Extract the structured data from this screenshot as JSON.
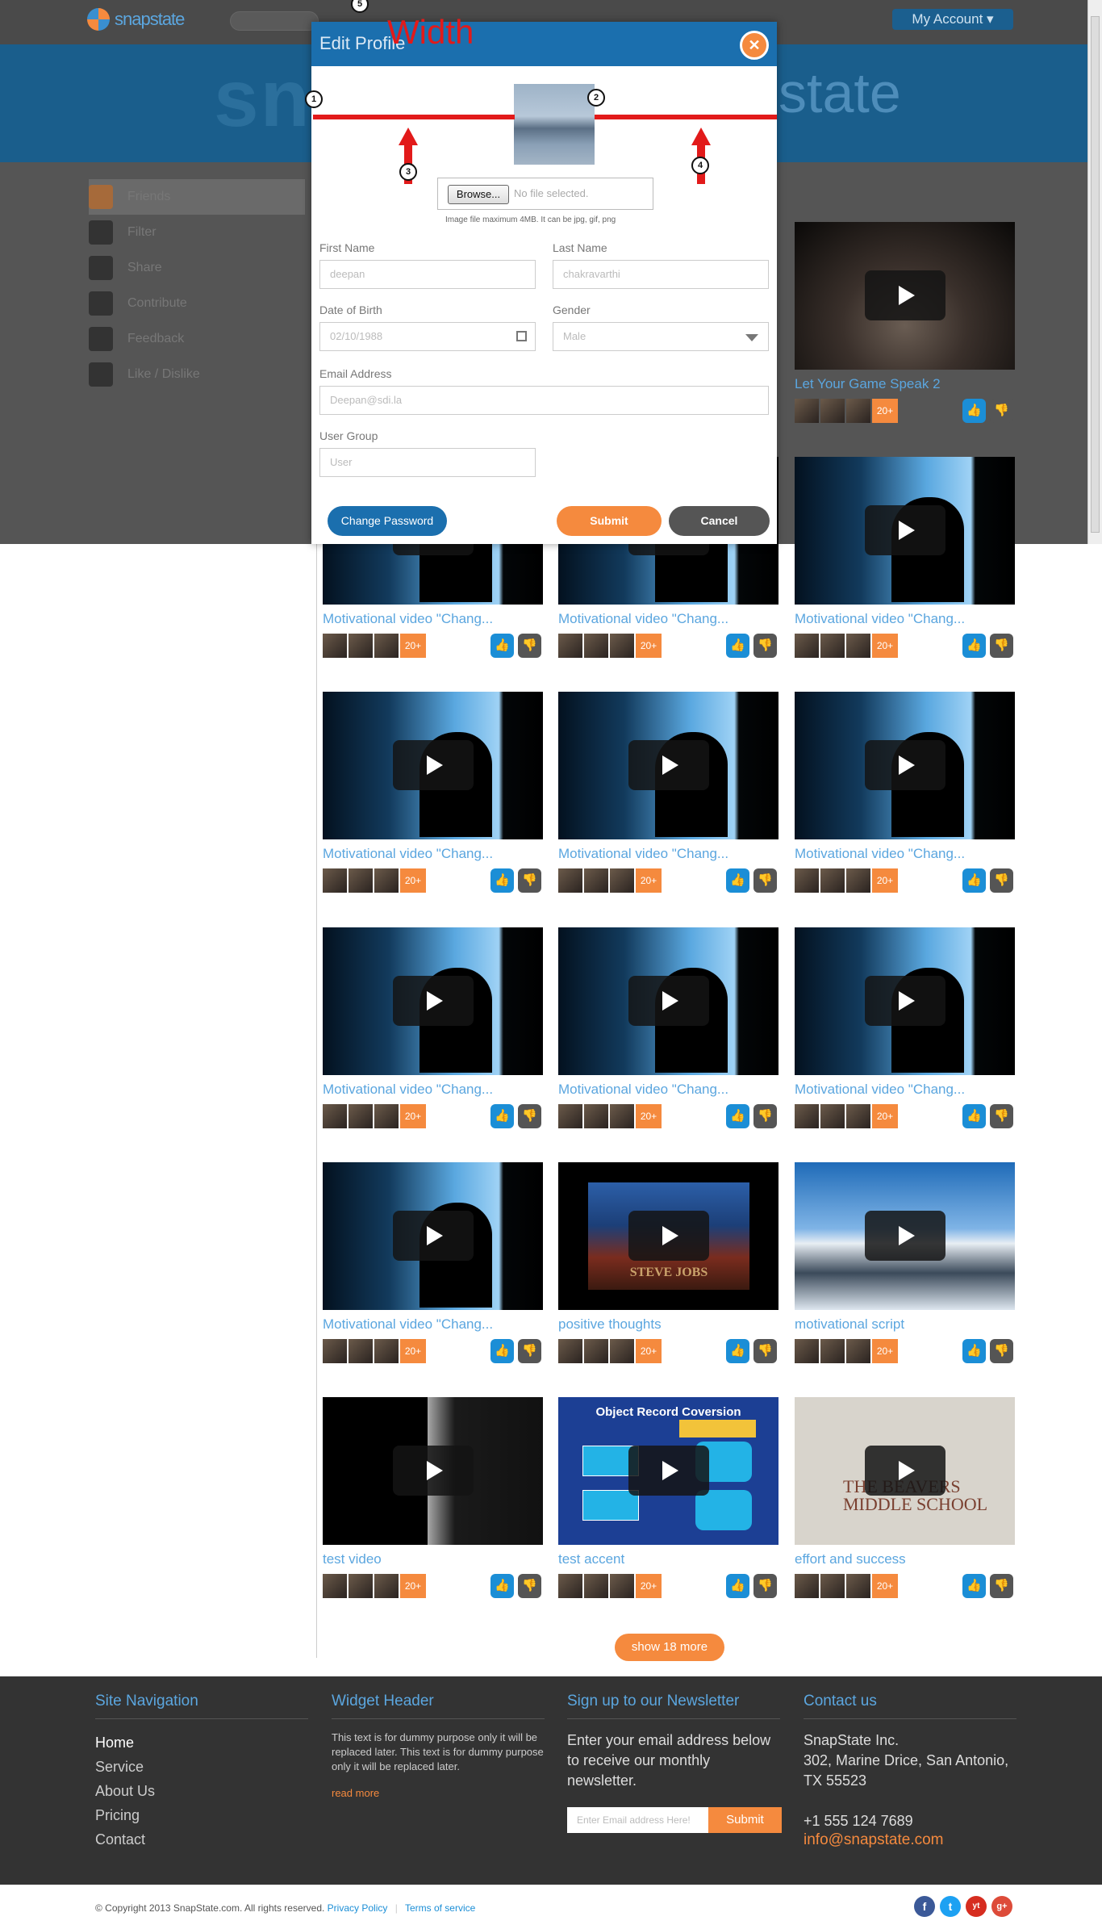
{
  "header": {
    "logo_text": "snapstate",
    "account_label": "My Account ▾",
    "hero_text_left": "sn",
    "hero_text_right": "state"
  },
  "sidebar": {
    "items": [
      {
        "label": "Friends",
        "icon": "friends-icon"
      },
      {
        "label": "Filter",
        "icon": "filter-icon"
      },
      {
        "label": "Share",
        "icon": "share-icon"
      },
      {
        "label": "Contribute",
        "icon": "upload-icon"
      },
      {
        "label": "Feedback",
        "icon": "chat-icon"
      },
      {
        "label": "Like / Dislike",
        "icon": "like-icon"
      }
    ]
  },
  "modal": {
    "title": "Edit Profile",
    "annotation_label": "Width",
    "markers": [
      "1",
      "2",
      "3",
      "4",
      "5"
    ],
    "browse_label": "Browse...",
    "no_file": "No file selected.",
    "image_hint": "Image file maximum 4MB. It can be jpg, gif, png",
    "first_name_label": "First Name",
    "first_name_value": "deepan",
    "last_name_label": "Last Name",
    "last_name_value": "chakravarthi",
    "dob_label": "Date of Birth",
    "dob_value": "02/10/1988",
    "gender_label": "Gender",
    "gender_value": "Male",
    "email_label": "Email Address",
    "email_value": "Deepan@sdi.la",
    "group_label": "User Group",
    "group_value": "User",
    "change_password": "Change Password",
    "submit": "Submit",
    "cancel": "Cancel"
  },
  "videos": {
    "count_label": "20+",
    "row1": [
      {
        "title": "",
        "kind": "hidden"
      },
      {
        "title": "",
        "kind": "hidden"
      },
      {
        "title": "Let Your Game Speak 2",
        "kind": "cat"
      }
    ],
    "row2": [
      {
        "title": "Motivational video \"Chang..."
      },
      {
        "title": "Motivational video \"Chang..."
      },
      {
        "title": "Motivational video \"Chang..."
      }
    ],
    "row3": [
      {
        "title": "Motivational video \"Chang..."
      },
      {
        "title": "Motivational video \"Chang..."
      },
      {
        "title": "Motivational video \"Chang..."
      }
    ],
    "row4": [
      {
        "title": "Motivational video \"Chang..."
      },
      {
        "title": "Motivational video \"Chang..."
      },
      {
        "title": "Motivational video \"Chang..."
      }
    ],
    "row5": [
      {
        "title": "Motivational video \"Chang..."
      },
      {
        "title": "positive thoughts"
      },
      {
        "title": "motivational script"
      }
    ],
    "row6": [
      {
        "title": "test video"
      },
      {
        "title": "test accent"
      },
      {
        "title": "effort and success"
      }
    ],
    "thumb_text": {
      "steve": "STEVE JOBS",
      "object_title": "Object Record Coversion",
      "effort": "THE BEAVERS MIDDLE SCHOOL"
    },
    "show_more": "show 18 more"
  },
  "footer": {
    "nav_title": "Site Navigation",
    "nav": [
      "Home",
      "Service",
      "About Us",
      "Pricing",
      "Contact"
    ],
    "widget_title": "Widget Header",
    "widget_text": "This text is for dummy purpose only it will be replaced later. This text is for dummy purpose only it will be replaced later.",
    "read_more": "read more",
    "newsletter_title": "Sign up to our Newsletter",
    "newsletter_text": "Enter your email address below to receive our monthly newsletter.",
    "newsletter_placeholder": "Enter Email address Here!",
    "newsletter_submit": "Submit",
    "contact_title": "Contact us",
    "company": "SnapState Inc.",
    "address1": "302, Marine Drice, San Antonio,",
    "address2": "TX 55523",
    "phone": "+1 555 124 7689",
    "email": "info@snapstate.com",
    "copyright": "© Copyright 2013 SnapState.com. All rights reserved.",
    "privacy": "Privacy Policy",
    "terms": "Terms of service",
    "social": [
      "f",
      "t",
      "yt",
      "g+"
    ]
  },
  "colors": {
    "accent": "#f58a3e",
    "brand_blue": "#1b6fae",
    "link_blue": "#5ba6df",
    "annotation_red": "#e21a1a"
  }
}
